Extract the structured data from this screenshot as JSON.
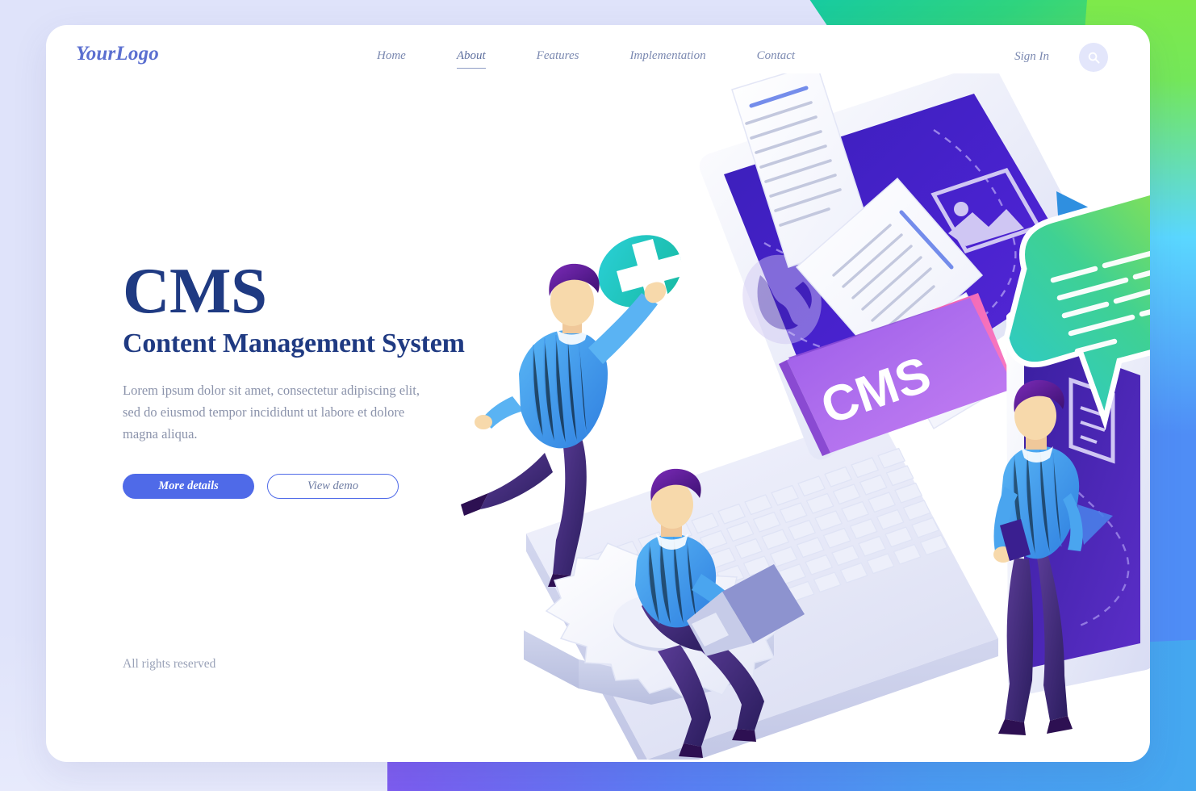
{
  "page": {
    "background_colors": {
      "top_left": "#dfe3fa",
      "top_right_green": "#7ee94a",
      "top_right_teal": "#13c9a6",
      "bottom_purple": "#c44fe0",
      "bottom_blue": "#45a8f0",
      "card": "#ffffff"
    }
  },
  "header": {
    "logo": "YourLogo",
    "nav": [
      {
        "label": "Home",
        "active": false
      },
      {
        "label": "About",
        "active": true
      },
      {
        "label": "Features",
        "active": false
      },
      {
        "label": "Implementation",
        "active": false
      },
      {
        "label": "Contact",
        "active": false
      }
    ],
    "signin_label": "Sign In",
    "search_icon": "search-icon",
    "accent_color": "#5b6fd0",
    "nav_color": "#7a88b0"
  },
  "hero": {
    "title": "CMS",
    "subtitle": "Content Management System",
    "description": "Lorem ipsum dolor sit amet, consectetur adipiscing elit, sed do eiusmod tempor incididunt ut labore et dolore magna aliqua.",
    "primary_button": "More details",
    "secondary_button": "View demo",
    "title_color": "#1f3a82",
    "primary_button_color": "#4f6ae8"
  },
  "footer": {
    "rights": "All rights reserved"
  },
  "illustration": {
    "folder_label": "CMS",
    "devices": [
      {
        "name": "laptop",
        "screen_color": "#3b20c9"
      },
      {
        "name": "smartphone",
        "screen_color": "#3b1fa8"
      }
    ],
    "icons": [
      "plus-circle-icon",
      "image-icon",
      "info-icon",
      "globe-icon",
      "document-icon",
      "gear-icon",
      "speech-bubble-icon",
      "send-arrow-icon"
    ],
    "characters": [
      {
        "name": "person-reaching-plus",
        "sweater_color": "#3d9ef2",
        "pants_color": "#4a2d86"
      },
      {
        "name": "person-sitting-on-gear-with-laptop",
        "sweater_color": "#2fa8e8",
        "pants_color": "#3d2478"
      },
      {
        "name": "person-standing-with-phone",
        "sweater_color": "#4aa5ef",
        "pants_color": "#5a3c96"
      }
    ],
    "accent_colors": {
      "folder_purple": "#a259e6",
      "folder_pink": "#f75fb0",
      "plus_teal": "#1fc7b6",
      "bubble_green": "#8ede3c",
      "bubble_teal": "#2ec7c7"
    }
  }
}
